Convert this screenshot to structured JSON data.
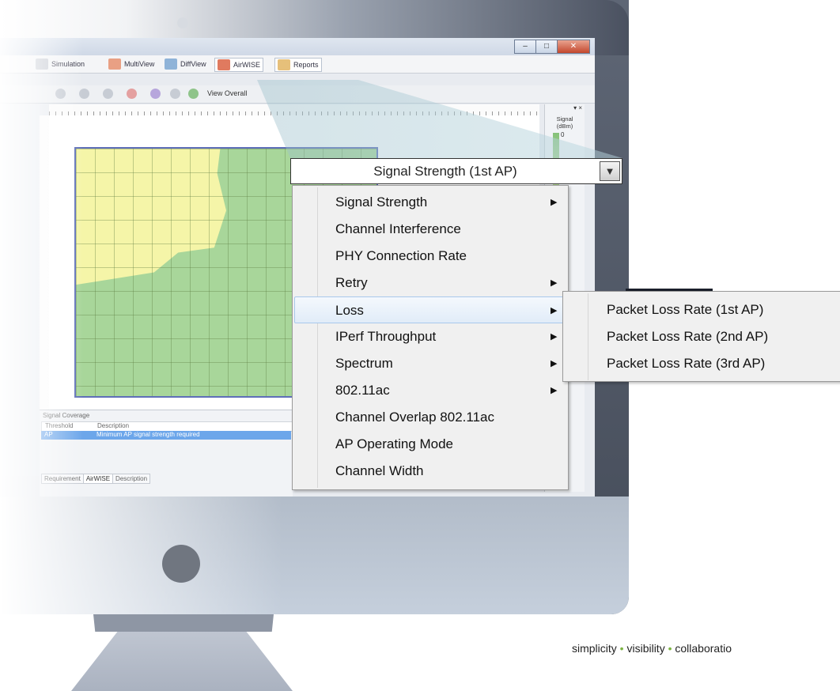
{
  "ribbon": {
    "tabs": [
      {
        "label": "Simulation",
        "icon": "simulation-icon"
      },
      {
        "label": "MultiView",
        "icon": "multiview-icon"
      },
      {
        "label": "DiffView",
        "icon": "diffview-icon"
      },
      {
        "label": "AirWISE",
        "icon": "airwise-icon"
      },
      {
        "label": "Reports",
        "icon": "reports-icon"
      }
    ]
  },
  "toolbar": {
    "view_label": "View Overall"
  },
  "window_controls": {
    "minimize": "–",
    "maximize": "□",
    "close": "✕"
  },
  "legend": {
    "pin": "▾ ×",
    "title_line1": "Signal",
    "title_line2": "(dBm)",
    "top_value": "0"
  },
  "bottom_panel": {
    "title": "Signal Coverage",
    "col_threshold": "Threshold",
    "col_description": "Description",
    "row_threshold": "AP",
    "row_description": "Minimum AP signal strength required",
    "tabs": [
      "Requirement",
      "AirWISE",
      "Description"
    ]
  },
  "dropdown": {
    "selected": "Signal Strength (1st AP)",
    "arrow": "▼"
  },
  "menu": {
    "items": [
      {
        "label": "Signal Strength",
        "has_submenu": true
      },
      {
        "label": "Channel Interference",
        "has_submenu": false
      },
      {
        "label": "PHY Connection Rate",
        "has_submenu": false
      },
      {
        "label": "Retry",
        "has_submenu": true
      },
      {
        "label": "Loss",
        "has_submenu": true,
        "highlighted": true
      },
      {
        "label": "IPerf Throughput",
        "has_submenu": true
      },
      {
        "label": "Spectrum",
        "has_submenu": true
      },
      {
        "label": "802.11ac",
        "has_submenu": true
      },
      {
        "label": "Channel Overlap 802.11ac",
        "has_submenu": false
      },
      {
        "label": "AP Operating Mode",
        "has_submenu": false
      },
      {
        "label": "Channel Width",
        "has_submenu": false
      }
    ],
    "submenu_arrow": "▶"
  },
  "submenu": {
    "items": [
      {
        "label": "Packet Loss Rate (1st AP)"
      },
      {
        "label": "Packet Loss Rate (2nd AP)"
      },
      {
        "label": "Packet Loss Rate (3rd AP)"
      }
    ]
  },
  "tagline": {
    "word1": "simplicity",
    "word2": "visibility",
    "word3": "collaboratio",
    "separator": "•"
  },
  "colors": {
    "coverage_strong": "#a8d69a",
    "coverage_weak": "#f5f5a8",
    "selection_blue": "#6ca6ea",
    "tagline_dot": "#7cb342"
  }
}
